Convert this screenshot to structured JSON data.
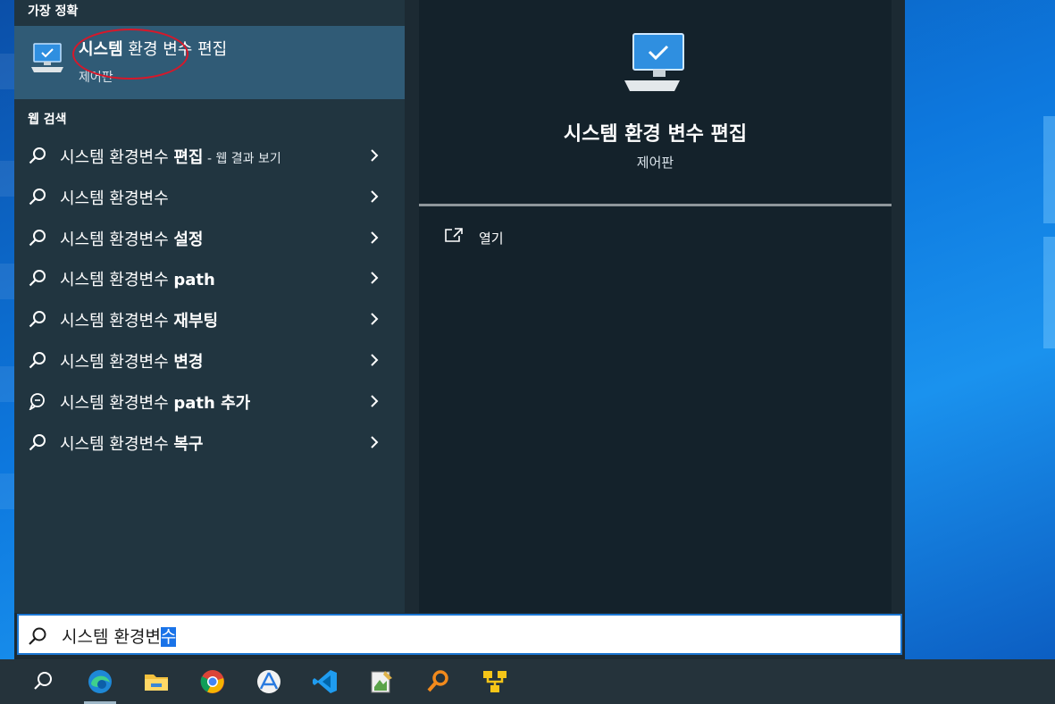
{
  "best_match": {
    "section_label": "가장 정확",
    "title_bold": "시스템",
    "title_rest": " 환경 변수 편집",
    "subtitle": "제어판"
  },
  "web_search": {
    "section_label": "웹 검색",
    "items": [
      {
        "prefix": "시스템 환경변수 ",
        "strong": "편집",
        "hint": " - 웹 결과 보기",
        "icon": "search-icon"
      },
      {
        "prefix": "시스템 환경변수",
        "strong": "",
        "hint": "",
        "icon": "search-icon"
      },
      {
        "prefix": "시스템 환경변수 ",
        "strong": "설정",
        "hint": "",
        "icon": "search-icon"
      },
      {
        "prefix": "시스템 환경변수 ",
        "strong": "path",
        "hint": "",
        "icon": "search-icon"
      },
      {
        "prefix": "시스템 환경변수 ",
        "strong": "재부팅",
        "hint": "",
        "icon": "search-icon"
      },
      {
        "prefix": "시스템 환경변수 ",
        "strong": "변경",
        "hint": "",
        "icon": "search-icon"
      },
      {
        "prefix": "시스템 환경변수 ",
        "strong": "path 추가",
        "hint": "",
        "icon": "chat-search-icon"
      },
      {
        "prefix": "시스템 환경변수 ",
        "strong": "복구",
        "hint": "",
        "icon": "search-icon"
      }
    ]
  },
  "preview": {
    "title": "시스템 환경 변수 편집",
    "subtitle": "제어판",
    "open_label": "열기"
  },
  "search_box": {
    "typed_text": "시스템 환경변",
    "selected_text": "수"
  },
  "taskbar": {
    "items": [
      {
        "name": "taskbar-search",
        "icon": "search-icon"
      },
      {
        "name": "taskbar-edge",
        "icon": "edge-icon"
      },
      {
        "name": "taskbar-file-explorer",
        "icon": "folder-icon"
      },
      {
        "name": "taskbar-chrome",
        "icon": "chrome-icon"
      },
      {
        "name": "taskbar-app-store",
        "icon": "app-store-icon"
      },
      {
        "name": "taskbar-vscode",
        "icon": "vscode-icon"
      },
      {
        "name": "taskbar-notepad",
        "icon": "notepad-icon"
      },
      {
        "name": "taskbar-search-tool",
        "icon": "magnifier-icon"
      },
      {
        "name": "taskbar-network-tool",
        "icon": "network-tool-icon"
      }
    ]
  },
  "colors": {
    "accent": "#1a73e8",
    "annotation": "#d7182a",
    "highlight": "#305b76"
  }
}
